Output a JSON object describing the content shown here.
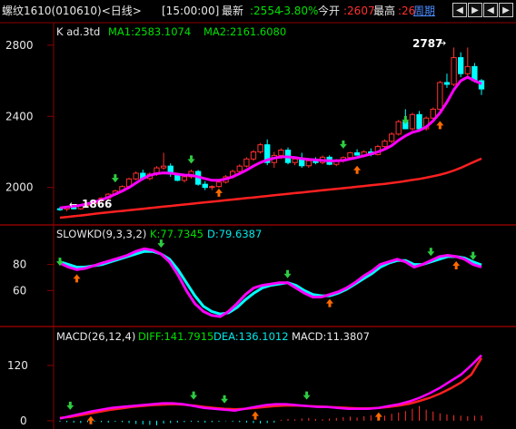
{
  "header": {
    "title": "螺纹1610(010610)<日线>",
    "time": "[15:00:00]",
    "latest_label": "最新",
    "latest_value": ":2554",
    "change": "-3.80%",
    "open_label": "今开",
    "open_value": ":2607",
    "high_label": "最高",
    "high_value": ":26",
    "period_link": "周期",
    "nav_buttons": [
      "◀",
      "▶",
      "◀",
      "▶"
    ]
  },
  "colors": {
    "background": "#000000",
    "grid": "#8b0000",
    "up": "#ff3030",
    "down": "#00ffff",
    "ma1": "#ff00ff",
    "ma2": "#ff2020",
    "text_green": "#00e000",
    "label_gray": "#e8e8e8"
  },
  "price_panel": {
    "label": "K  ad.3td",
    "ma1_label": "MA1:2583.1074",
    "ma2_label": "MA2:2161.6080",
    "y_ticks": [
      "2800",
      "2400",
      "2000"
    ],
    "y_tick_values": [
      2800,
      2400,
      2000
    ],
    "ylim": [
      1830,
      2840
    ],
    "high_annotation": "2787",
    "low_annotation": "1866"
  },
  "kd_panel": {
    "label": "SLOWKD(9,3,3,2)",
    "k_label": "K:77.7345",
    "d_label": "D:79.6387",
    "y_ticks": [
      "80",
      "60"
    ],
    "y_tick_values": [
      80,
      60
    ],
    "ylim": [
      38,
      95
    ]
  },
  "macd_panel": {
    "label": "MACD(26,12,4)",
    "diff_label": "DIFF:141.7915",
    "dea_label": "DEA:136.1012",
    "macd_label": "MACD:11.3807",
    "y_ticks": [
      "120",
      "0"
    ],
    "y_tick_values": [
      120,
      0
    ],
    "ylim": [
      -12,
      165
    ]
  },
  "chart_data": {
    "type": "candlestick",
    "n_days": 62,
    "ohlc": [
      [
        1880,
        1890,
        1868,
        1878
      ],
      [
        1878,
        1892,
        1866,
        1886
      ],
      [
        1886,
        1898,
        1876,
        1880
      ],
      [
        1880,
        1905,
        1875,
        1900
      ],
      [
        1900,
        1915,
        1892,
        1910
      ],
      [
        1910,
        1930,
        1902,
        1925
      ],
      [
        1925,
        1945,
        1918,
        1940
      ],
      [
        1940,
        1968,
        1932,
        1962
      ],
      [
        1962,
        1988,
        1955,
        1980
      ],
      [
        1980,
        2012,
        1972,
        2005
      ],
      [
        2005,
        2055,
        1998,
        2048
      ],
      [
        2048,
        2090,
        2040,
        2080
      ],
      [
        2080,
        2100,
        2040,
        2050
      ],
      [
        2050,
        2085,
        2040,
        2075
      ],
      [
        2075,
        2120,
        2065,
        2110
      ],
      [
        2110,
        2195,
        2100,
        2120
      ],
      [
        2120,
        2135,
        2060,
        2075
      ],
      [
        2075,
        2082,
        2035,
        2040
      ],
      [
        2040,
        2068,
        2028,
        2060
      ],
      [
        2060,
        2100,
        2050,
        2090
      ],
      [
        2090,
        2098,
        2010,
        2018
      ],
      [
        2018,
        2035,
        1985,
        2000
      ],
      [
        2000,
        2012,
        1985,
        2005
      ],
      [
        2005,
        2040,
        1998,
        2030
      ],
      [
        2030,
        2070,
        2022,
        2060
      ],
      [
        2060,
        2100,
        2050,
        2090
      ],
      [
        2090,
        2130,
        2080,
        2120
      ],
      [
        2120,
        2170,
        2112,
        2160
      ],
      [
        2160,
        2210,
        2150,
        2200
      ],
      [
        2200,
        2250,
        2190,
        2240
      ],
      [
        2240,
        2270,
        2125,
        2140
      ],
      [
        2140,
        2200,
        2110,
        2180
      ],
      [
        2180,
        2220,
        2160,
        2210
      ],
      [
        2210,
        2225,
        2130,
        2140
      ],
      [
        2140,
        2172,
        2125,
        2160
      ],
      [
        2160,
        2195,
        2110,
        2122
      ],
      [
        2122,
        2165,
        2110,
        2150
      ],
      [
        2150,
        2170,
        2130,
        2140
      ],
      [
        2140,
        2180,
        2130,
        2170
      ],
      [
        2170,
        2180,
        2125,
        2130
      ],
      [
        2130,
        2160,
        2120,
        2150
      ],
      [
        2150,
        2175,
        2140,
        2168
      ],
      [
        2168,
        2200,
        2160,
        2195
      ],
      [
        2195,
        2215,
        2178,
        2182
      ],
      [
        2182,
        2210,
        2170,
        2200
      ],
      [
        2200,
        2220,
        2175,
        2185
      ],
      [
        2185,
        2240,
        2180,
        2230
      ],
      [
        2230,
        2270,
        2220,
        2260
      ],
      [
        2260,
        2310,
        2250,
        2300
      ],
      [
        2300,
        2380,
        2292,
        2370
      ],
      [
        2370,
        2440,
        2360,
        2330
      ],
      [
        2330,
        2420,
        2320,
        2410
      ],
      [
        2410,
        2430,
        2320,
        2330
      ],
      [
        2330,
        2400,
        2320,
        2390
      ],
      [
        2390,
        2450,
        2380,
        2440
      ],
      [
        2440,
        2600,
        2430,
        2590
      ],
      [
        2590,
        2640,
        2560,
        2580
      ],
      [
        2580,
        2787,
        2570,
        2730
      ],
      [
        2730,
        2760,
        2620,
        2640
      ],
      [
        2640,
        2787,
        2620,
        2680
      ],
      [
        2680,
        2700,
        2590,
        2600
      ],
      [
        2600,
        2610,
        2520,
        2554
      ]
    ],
    "ma1": [
      1885,
      1890,
      1895,
      1900,
      1908,
      1918,
      1930,
      1945,
      1962,
      1980,
      2000,
      2025,
      2050,
      2068,
      2078,
      2082,
      2080,
      2075,
      2070,
      2068,
      2060,
      2050,
      2040,
      2040,
      2048,
      2060,
      2078,
      2098,
      2120,
      2140,
      2155,
      2165,
      2172,
      2172,
      2168,
      2162,
      2158,
      2155,
      2152,
      2150,
      2150,
      2152,
      2160,
      2168,
      2178,
      2188,
      2200,
      2215,
      2235,
      2265,
      2290,
      2310,
      2320,
      2340,
      2375,
      2420,
      2480,
      2550,
      2600,
      2620,
      2600,
      2583
    ],
    "ma2": [
      1830,
      1834,
      1838,
      1842,
      1847,
      1852,
      1856,
      1860,
      1864,
      1868,
      1872,
      1876,
      1880,
      1884,
      1888,
      1892,
      1896,
      1900,
      1904,
      1908,
      1912,
      1916,
      1920,
      1924,
      1928,
      1932,
      1936,
      1940,
      1944,
      1948,
      1952,
      1956,
      1960,
      1964,
      1968,
      1972,
      1976,
      1980,
      1984,
      1988,
      1992,
      1996,
      2000,
      2004,
      2008,
      2012,
      2016,
      2020,
      2025,
      2030,
      2036,
      2042,
      2048,
      2055,
      2063,
      2072,
      2082,
      2095,
      2110,
      2128,
      2145,
      2162
    ],
    "kd_k": [
      81,
      78,
      76,
      77,
      79,
      81,
      83,
      85,
      87,
      90,
      92,
      91,
      88,
      82,
      72,
      60,
      50,
      44,
      41,
      40,
      44,
      50,
      57,
      62,
      64,
      65,
      66,
      66,
      62,
      58,
      55,
      55,
      57,
      59,
      62,
      66,
      71,
      75,
      80,
      82,
      84,
      82,
      78,
      80,
      83,
      86,
      87,
      86,
      84,
      80,
      78
    ],
    "kd_d": [
      82,
      80,
      78,
      78,
      79,
      80,
      82,
      84,
      86,
      88,
      90,
      90,
      88,
      84,
      76,
      66,
      56,
      48,
      44,
      42,
      43,
      47,
      53,
      58,
      62,
      64,
      65,
      66,
      64,
      60,
      57,
      56,
      56,
      58,
      61,
      65,
      69,
      73,
      78,
      81,
      83,
      83,
      80,
      80,
      82,
      84,
      86,
      86,
      85,
      82,
      79.6
    ],
    "macd_diff": [
      5,
      10,
      15,
      20,
      24,
      28,
      30,
      32,
      34,
      36,
      38,
      38,
      36,
      32,
      28,
      26,
      24,
      22,
      26,
      30,
      34,
      36,
      36,
      34,
      32,
      30,
      30,
      28,
      26,
      26,
      26,
      28,
      32,
      36,
      42,
      50,
      60,
      72,
      86,
      100,
      120,
      142
    ],
    "macd_dea": [
      6,
      8,
      12,
      16,
      20,
      24,
      27,
      30,
      32,
      34,
      35,
      36,
      35,
      33,
      30,
      28,
      26,
      25,
      26,
      28,
      30,
      32,
      33,
      33,
      32,
      31,
      30,
      29,
      28,
      27,
      27,
      28,
      30,
      33,
      37,
      43,
      50,
      59,
      70,
      83,
      100,
      136
    ],
    "macd_hist": [
      -2,
      -3,
      -4,
      -5,
      -3,
      -2,
      -3,
      -4,
      -2,
      -3,
      -5,
      -7,
      -8,
      -9,
      -10,
      -6,
      -5,
      -4,
      -3,
      -2,
      -3,
      -4,
      -3,
      -2,
      -1,
      -2,
      -3,
      -4,
      -5,
      -6,
      -5,
      -4,
      2,
      4,
      3,
      5,
      6,
      4,
      3,
      5,
      6,
      8,
      9,
      7,
      10,
      12,
      9,
      11,
      15,
      18,
      21,
      26,
      32,
      24,
      20,
      16,
      14,
      12,
      11,
      10,
      11,
      11
    ]
  }
}
